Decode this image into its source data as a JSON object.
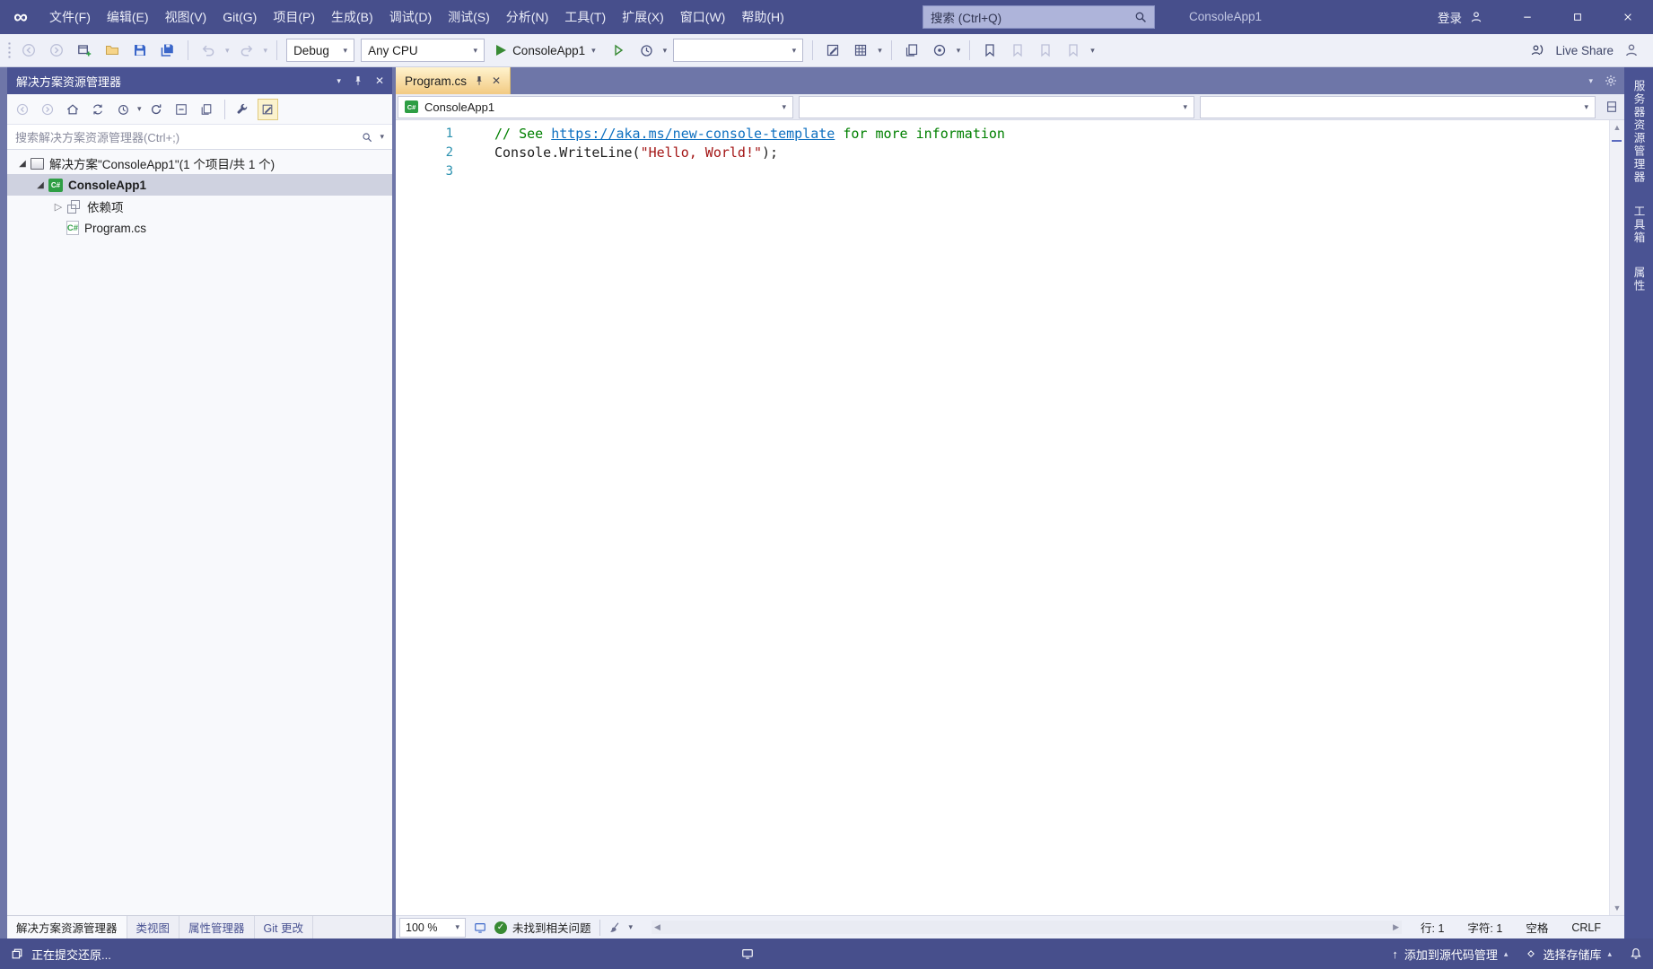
{
  "colors": {
    "titlebar": "#474F8C",
    "accent": "#4A5393",
    "docwell": "#6E76A8",
    "toolbar-bg": "#EEF0F8",
    "panel-bg": "#F8F9FC",
    "panel-strip": "#EDEEF5",
    "selection": "#CFD2E0",
    "tab-top": "#FFF3CE",
    "tab-bottom": "#F2CA82",
    "comment": "#008000",
    "string": "#A31515",
    "link": "#0E70C0",
    "lineno": "#2B91AF",
    "code-fg": "#1E1E1E",
    "check-green": "#388A34",
    "play-green": "#388A34"
  },
  "icons": {
    "caret-down": "▾",
    "caret-up": "▴",
    "close": "✕",
    "check": "✓",
    "tree-expanded": "◢",
    "tree-collapsed": "▷",
    "scroll-up": "▲",
    "scroll-down": "▼",
    "scroll-left": "◀",
    "scroll-right": "▶",
    "csharp": "C#",
    "logo": "∞",
    "up-arrow": "↑"
  },
  "title_bar": {
    "menus": [
      "文件(F)",
      "编辑(E)",
      "视图(V)",
      "Git(G)",
      "项目(P)",
      "生成(B)",
      "调试(D)",
      "测试(S)",
      "分析(N)",
      "工具(T)",
      "扩展(X)",
      "窗口(W)",
      "帮助(H)"
    ],
    "search_placeholder": "搜索 (Ctrl+Q)",
    "solution_name": "ConsoleApp1",
    "sign_in_label": "登录"
  },
  "toolbar": {
    "configuration": "Debug",
    "platform": "Any CPU",
    "start_button_label": "ConsoleApp1",
    "live_share_label": "Live Share"
  },
  "solution_explorer": {
    "title": "解决方案资源管理器",
    "search_placeholder": "搜索解决方案资源管理器(Ctrl+;)",
    "tree": [
      {
        "label": "解决方案\"ConsoleApp1\"(1 个项目/共 1 个)",
        "icon": "solution",
        "arrow": "expanded",
        "indent": 0,
        "selected": false,
        "bold": false
      },
      {
        "label": "ConsoleApp1",
        "icon": "csproj",
        "arrow": "expanded",
        "indent": 1,
        "selected": true,
        "bold": true
      },
      {
        "label": "依赖项",
        "icon": "dependencies",
        "arrow": "collapsed",
        "indent": 2,
        "selected": false,
        "bold": false
      },
      {
        "label": "Program.cs",
        "icon": "csfile",
        "arrow": "none",
        "indent": 2,
        "selected": false,
        "bold": false
      }
    ],
    "bottom_tabs": [
      {
        "label": "解决方案资源管理器",
        "active": true
      },
      {
        "label": "类视图",
        "active": false
      },
      {
        "label": "属性管理器",
        "active": false
      },
      {
        "label": "Git 更改",
        "active": false
      }
    ]
  },
  "editor": {
    "tab_title": "Program.cs",
    "navbar_project": "ConsoleApp1",
    "code": [
      {
        "tokens": [
          {
            "t": "// See ",
            "c": "comment"
          },
          {
            "t": "https://aka.ms/new-console-template",
            "c": "link"
          },
          {
            "t": " for more information",
            "c": "comment"
          }
        ]
      },
      {
        "tokens": [
          {
            "t": "Console.WriteLine(",
            "c": "plain"
          },
          {
            "t": "\"Hello, World!\"",
            "c": "string"
          },
          {
            "t": ");",
            "c": "plain"
          }
        ]
      },
      {
        "tokens": []
      }
    ],
    "status": {
      "zoom": "100 %",
      "health": "未找到相关问题",
      "line": "行: 1",
      "column": "字符: 1",
      "spaces": "空格",
      "line_ending": "CRLF"
    }
  },
  "right_tool_tabs": [
    "服务器资源管理器",
    "工具箱",
    "属性"
  ],
  "status_bar": {
    "message": "正在提交还原...",
    "add_to_source_control": "添加到源代码管理",
    "select_repository": "选择存储库"
  }
}
